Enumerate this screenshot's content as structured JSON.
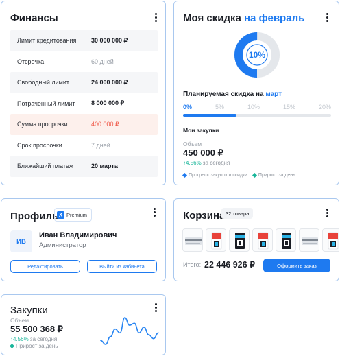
{
  "finance": {
    "title": "Финансы",
    "rows": [
      {
        "label": "Лимит кредитования",
        "value": "30 000 000 ₽"
      },
      {
        "label": "Отсрочка",
        "value": "60 дней"
      },
      {
        "label": "Свободный лимит",
        "value": "24 000 000 ₽"
      },
      {
        "label": "Потраченный лимит",
        "value": "8 000 000 ₽"
      },
      {
        "label": "Сумма просрочки",
        "value": "400 000 ₽"
      },
      {
        "label": "Срок просрочки",
        "value": "7 дней"
      },
      {
        "label": "Ближайший платеж",
        "value": "20 марта"
      }
    ]
  },
  "discount": {
    "title": "Моя скидка",
    "title_accent": "на февраль",
    "percent_text": "10%",
    "percent_fraction": 0.5,
    "plan_label": "Планируемая скидка на",
    "plan_accent": "март",
    "ticks": [
      "0%",
      "5%",
      "10%",
      "15%",
      "20%"
    ],
    "plan_progress_fraction": 0.36,
    "purchases_title": "Мои закупки",
    "volume_label": "Объем",
    "volume_value": "450 000 ₽",
    "delta_value": "↑4.56%",
    "delta_suffix": "за сегодня",
    "legend": [
      {
        "label": "Прогресс закупок и скидки",
        "color": "#1e7af0"
      },
      {
        "label": "Прирост за день",
        "color": "#19b69a"
      }
    ]
  },
  "profile": {
    "title": "Профиль",
    "badge_icon": "X",
    "badge_label": "Premium",
    "avatar_initials": "ИВ",
    "name": "Иван Владимирович",
    "role": "Администратор",
    "edit_label": "Редактировать",
    "logout_label": "Выйти из кабинета"
  },
  "cart": {
    "title": "Корзина",
    "count_label": "32 товара",
    "total_label": "Итого:",
    "total_value": "22 446 926 ₽",
    "order_label": "Оформить заказ",
    "products": [
      "printer",
      "ink-red",
      "ink-black",
      "ink-red",
      "ink-black",
      "printer",
      "ink-red"
    ]
  },
  "purchases": {
    "title": "Закупки",
    "volume_label": "Объем",
    "volume_value": "55 500 368 ₽",
    "delta_value": "↑4.56%",
    "delta_suffix": "за сегодня",
    "legend_label": "Прирост за день",
    "legend_color": "#19b69a",
    "sparkline": [
      22,
      18,
      26,
      34,
      30,
      46,
      38,
      40,
      30,
      36,
      28,
      24,
      30
    ]
  },
  "colors": {
    "accent": "#1e7af0",
    "positive": "#19b69a",
    "negative": "#f05a4a"
  }
}
